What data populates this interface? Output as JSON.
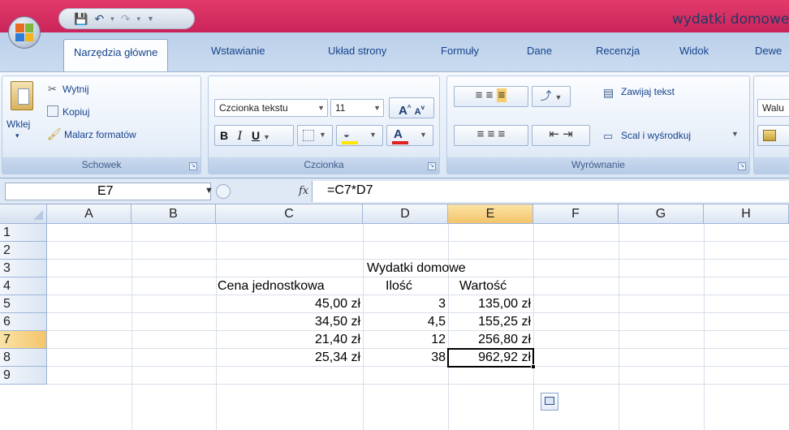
{
  "window": {
    "title": "wydatki domowe"
  },
  "quick_access": {
    "save_icon": "save-icon",
    "undo_icon": "undo-icon",
    "redo_icon": "redo-icon"
  },
  "ribbon_tabs": [
    {
      "label": "Narzędzia główne",
      "active": true
    },
    {
      "label": "Wstawianie"
    },
    {
      "label": "Układ strony"
    },
    {
      "label": "Formuły"
    },
    {
      "label": "Dane"
    },
    {
      "label": "Recenzja"
    },
    {
      "label": "Widok"
    },
    {
      "label": "Dewe"
    }
  ],
  "clipboard": {
    "group_label": "Schowek",
    "paste": "Wklej",
    "cut": "Wytnij",
    "copy": "Kopiuj",
    "format_painter": "Malarz formatów"
  },
  "font": {
    "group_label": "Czcionka",
    "font_name": "Czcionka tekstu",
    "font_size": "11"
  },
  "alignment": {
    "group_label": "Wyrównanie",
    "wrap_text": "Zawijaj tekst",
    "merge_center": "Scal i wyśrodkuj"
  },
  "number": {
    "format": "Walu"
  },
  "formula_bar": {
    "name_box": "E7",
    "fx": "fx",
    "formula": "=C7*D7"
  },
  "columns": [
    "A",
    "B",
    "C",
    "D",
    "E",
    "F",
    "G",
    "H"
  ],
  "rows": [
    "1",
    "2",
    "3",
    "4",
    "5",
    "6",
    "7",
    "8",
    "9"
  ],
  "selected_cell": "E7",
  "sheet": {
    "title": "Wydatki domowe",
    "headers": {
      "price": "Cena jednostkowa",
      "qty": "Ilość",
      "value": "Wartość"
    },
    "data": [
      {
        "price": "45,00 zł",
        "qty": "3",
        "value": "135,00 zł"
      },
      {
        "price": "34,50 zł",
        "qty": "4,5",
        "value": "155,25 zł"
      },
      {
        "price": "21,40 zł",
        "qty": "12",
        "value": "256,80 zł"
      },
      {
        "price": "25,34 zł",
        "qty": "38",
        "value": "962,92 zł"
      }
    ]
  },
  "colors": {
    "title_bar": "#d62e5f",
    "selection_header": "#f4c46a",
    "ribbon_text": "#15428b"
  }
}
